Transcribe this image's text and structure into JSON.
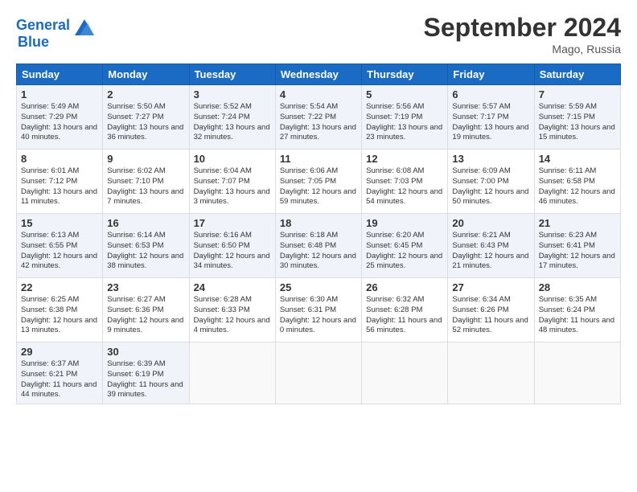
{
  "header": {
    "logo_line1": "General",
    "logo_line2": "Blue",
    "month_year": "September 2024",
    "location": "Mago, Russia"
  },
  "weekdays": [
    "Sunday",
    "Monday",
    "Tuesday",
    "Wednesday",
    "Thursday",
    "Friday",
    "Saturday"
  ],
  "weeks": [
    [
      {
        "day": "1",
        "sunrise": "Sunrise: 5:49 AM",
        "sunset": "Sunset: 7:29 PM",
        "daylight": "Daylight: 13 hours and 40 minutes."
      },
      {
        "day": "2",
        "sunrise": "Sunrise: 5:50 AM",
        "sunset": "Sunset: 7:27 PM",
        "daylight": "Daylight: 13 hours and 36 minutes."
      },
      {
        "day": "3",
        "sunrise": "Sunrise: 5:52 AM",
        "sunset": "Sunset: 7:24 PM",
        "daylight": "Daylight: 13 hours and 32 minutes."
      },
      {
        "day": "4",
        "sunrise": "Sunrise: 5:54 AM",
        "sunset": "Sunset: 7:22 PM",
        "daylight": "Daylight: 13 hours and 27 minutes."
      },
      {
        "day": "5",
        "sunrise": "Sunrise: 5:56 AM",
        "sunset": "Sunset: 7:19 PM",
        "daylight": "Daylight: 13 hours and 23 minutes."
      },
      {
        "day": "6",
        "sunrise": "Sunrise: 5:57 AM",
        "sunset": "Sunset: 7:17 PM",
        "daylight": "Daylight: 13 hours and 19 minutes."
      },
      {
        "day": "7",
        "sunrise": "Sunrise: 5:59 AM",
        "sunset": "Sunset: 7:15 PM",
        "daylight": "Daylight: 13 hours and 15 minutes."
      }
    ],
    [
      {
        "day": "8",
        "sunrise": "Sunrise: 6:01 AM",
        "sunset": "Sunset: 7:12 PM",
        "daylight": "Daylight: 13 hours and 11 minutes."
      },
      {
        "day": "9",
        "sunrise": "Sunrise: 6:02 AM",
        "sunset": "Sunset: 7:10 PM",
        "daylight": "Daylight: 13 hours and 7 minutes."
      },
      {
        "day": "10",
        "sunrise": "Sunrise: 6:04 AM",
        "sunset": "Sunset: 7:07 PM",
        "daylight": "Daylight: 13 hours and 3 minutes."
      },
      {
        "day": "11",
        "sunrise": "Sunrise: 6:06 AM",
        "sunset": "Sunset: 7:05 PM",
        "daylight": "Daylight: 12 hours and 59 minutes."
      },
      {
        "day": "12",
        "sunrise": "Sunrise: 6:08 AM",
        "sunset": "Sunset: 7:03 PM",
        "daylight": "Daylight: 12 hours and 54 minutes."
      },
      {
        "day": "13",
        "sunrise": "Sunrise: 6:09 AM",
        "sunset": "Sunset: 7:00 PM",
        "daylight": "Daylight: 12 hours and 50 minutes."
      },
      {
        "day": "14",
        "sunrise": "Sunrise: 6:11 AM",
        "sunset": "Sunset: 6:58 PM",
        "daylight": "Daylight: 12 hours and 46 minutes."
      }
    ],
    [
      {
        "day": "15",
        "sunrise": "Sunrise: 6:13 AM",
        "sunset": "Sunset: 6:55 PM",
        "daylight": "Daylight: 12 hours and 42 minutes."
      },
      {
        "day": "16",
        "sunrise": "Sunrise: 6:14 AM",
        "sunset": "Sunset: 6:53 PM",
        "daylight": "Daylight: 12 hours and 38 minutes."
      },
      {
        "day": "17",
        "sunrise": "Sunrise: 6:16 AM",
        "sunset": "Sunset: 6:50 PM",
        "daylight": "Daylight: 12 hours and 34 minutes."
      },
      {
        "day": "18",
        "sunrise": "Sunrise: 6:18 AM",
        "sunset": "Sunset: 6:48 PM",
        "daylight": "Daylight: 12 hours and 30 minutes."
      },
      {
        "day": "19",
        "sunrise": "Sunrise: 6:20 AM",
        "sunset": "Sunset: 6:45 PM",
        "daylight": "Daylight: 12 hours and 25 minutes."
      },
      {
        "day": "20",
        "sunrise": "Sunrise: 6:21 AM",
        "sunset": "Sunset: 6:43 PM",
        "daylight": "Daylight: 12 hours and 21 minutes."
      },
      {
        "day": "21",
        "sunrise": "Sunrise: 6:23 AM",
        "sunset": "Sunset: 6:41 PM",
        "daylight": "Daylight: 12 hours and 17 minutes."
      }
    ],
    [
      {
        "day": "22",
        "sunrise": "Sunrise: 6:25 AM",
        "sunset": "Sunset: 6:38 PM",
        "daylight": "Daylight: 12 hours and 13 minutes."
      },
      {
        "day": "23",
        "sunrise": "Sunrise: 6:27 AM",
        "sunset": "Sunset: 6:36 PM",
        "daylight": "Daylight: 12 hours and 9 minutes."
      },
      {
        "day": "24",
        "sunrise": "Sunrise: 6:28 AM",
        "sunset": "Sunset: 6:33 PM",
        "daylight": "Daylight: 12 hours and 4 minutes."
      },
      {
        "day": "25",
        "sunrise": "Sunrise: 6:30 AM",
        "sunset": "Sunset: 6:31 PM",
        "daylight": "Daylight: 12 hours and 0 minutes."
      },
      {
        "day": "26",
        "sunrise": "Sunrise: 6:32 AM",
        "sunset": "Sunset: 6:28 PM",
        "daylight": "Daylight: 11 hours and 56 minutes."
      },
      {
        "day": "27",
        "sunrise": "Sunrise: 6:34 AM",
        "sunset": "Sunset: 6:26 PM",
        "daylight": "Daylight: 11 hours and 52 minutes."
      },
      {
        "day": "28",
        "sunrise": "Sunrise: 6:35 AM",
        "sunset": "Sunset: 6:24 PM",
        "daylight": "Daylight: 11 hours and 48 minutes."
      }
    ],
    [
      {
        "day": "29",
        "sunrise": "Sunrise: 6:37 AM",
        "sunset": "Sunset: 6:21 PM",
        "daylight": "Daylight: 11 hours and 44 minutes."
      },
      {
        "day": "30",
        "sunrise": "Sunrise: 6:39 AM",
        "sunset": "Sunset: 6:19 PM",
        "daylight": "Daylight: 11 hours and 39 minutes."
      },
      null,
      null,
      null,
      null,
      null
    ]
  ]
}
